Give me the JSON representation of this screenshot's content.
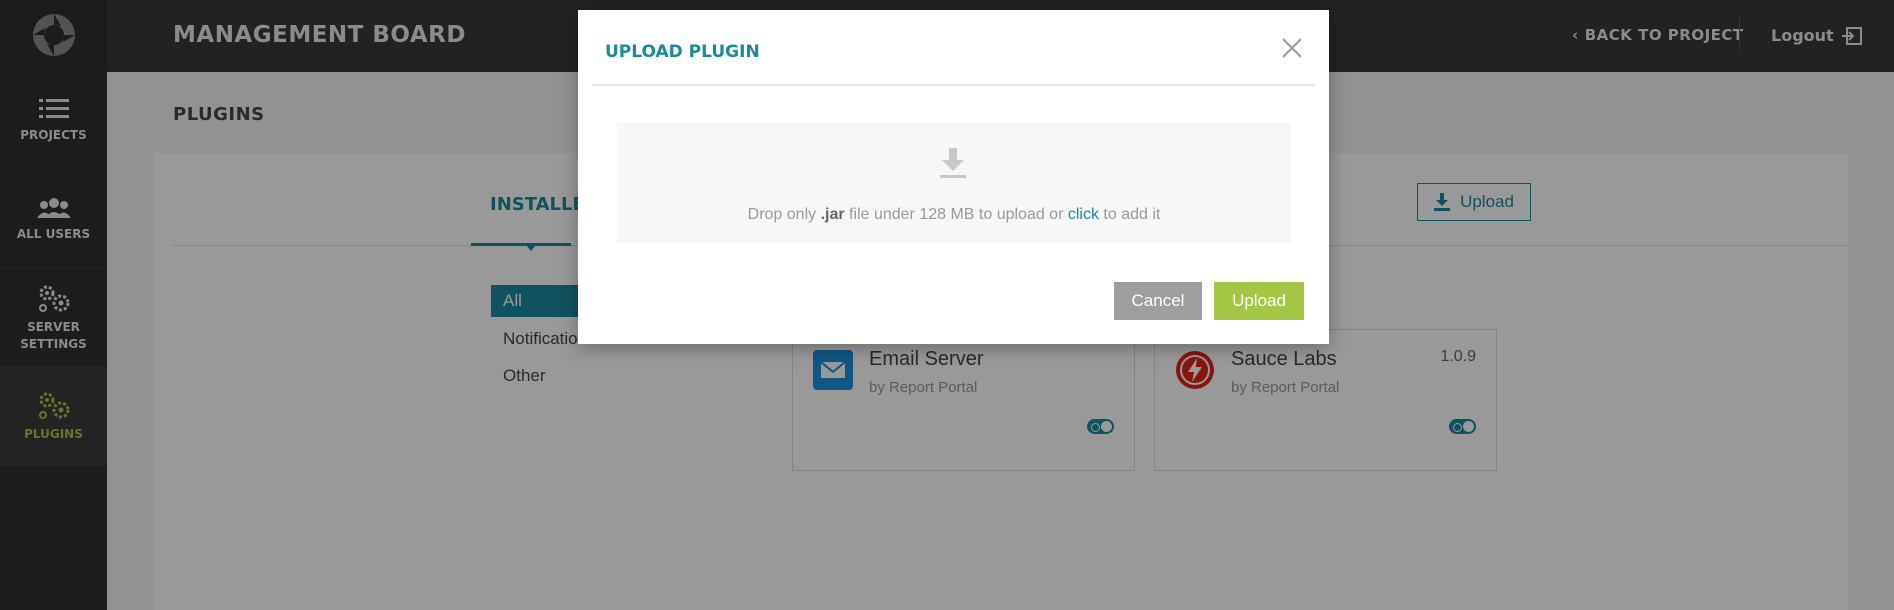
{
  "header": {
    "title": "MANAGEMENT BOARD",
    "back_link": "BACK TO PROJECT",
    "logout": "Logout"
  },
  "sidebar": {
    "items": [
      {
        "label": "PROJECTS",
        "icon": "list-icon"
      },
      {
        "label": "ALL USERS",
        "icon": "users-icon"
      },
      {
        "label_line1": "SERVER",
        "label_line2": "SETTINGS",
        "icon": "gears-icon"
      },
      {
        "label": "PLUGINS",
        "icon": "gears-icon",
        "active": true
      }
    ]
  },
  "page": {
    "title": "PLUGINS",
    "tab_installed": "INSTALLED",
    "upload_button": "Upload",
    "filters": [
      "All",
      "Notifications",
      "Other"
    ],
    "plugins": [
      {
        "name": "Email Server",
        "author": "by Report Portal",
        "version": "",
        "enabled": true
      },
      {
        "name": "Sauce Labs",
        "author": "by Report Portal",
        "version": "1.0.9",
        "enabled": true
      }
    ]
  },
  "modal": {
    "title": "UPLOAD PLUGIN",
    "drop_prefix": "Drop only",
    "drop_ext": ".jar",
    "drop_middle": "file under 128 MB to upload or",
    "drop_link": "click",
    "drop_suffix": "to add it",
    "cancel_label": "Cancel",
    "upload_label": "Upload"
  },
  "colors": {
    "accent": "#1a8a9e",
    "primary_action": "#a3c644",
    "sidebar_bg": "#2f2f2f",
    "header_bg": "#3a3a3a"
  }
}
